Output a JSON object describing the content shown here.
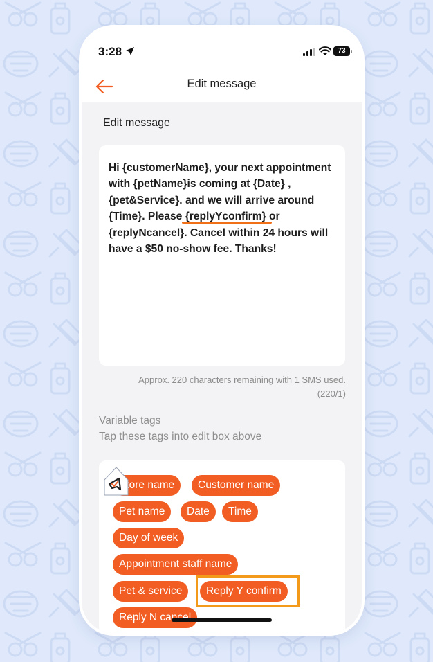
{
  "status_bar": {
    "time": "3:28",
    "battery": "73"
  },
  "nav": {
    "title": "Edit message"
  },
  "section_title": "Edit message",
  "message_lines": [
    "Hi {customerName}, your next appointment",
    "with {petName}is coming at {Date} ,",
    "{pet&Service}. and we will arrive around",
    "{Time}. Please {replyYconfirm} or",
    "{replyNcancel}. Cancel within 24 hours will",
    "have a $50 no-show fee. Thanks!"
  ],
  "char_count": {
    "line1": "Approx. 220 characters remaining with 1 SMS used.",
    "line2": "(220/1)"
  },
  "variable_tags": {
    "title": "Variable tags",
    "hint": "Tap these tags into edit box above",
    "tags": [
      "Store name",
      "Customer name",
      "Pet name",
      "Date",
      "Time",
      "Day of week",
      "Appointment staff name",
      "Pet & service",
      "Reply Y confirm",
      "Reply N cancel"
    ]
  },
  "colors": {
    "accent": "#f15d22",
    "highlight": "#f39a1a",
    "background": "#dfe9fb"
  },
  "icons": [
    "location-arrow-icon",
    "signal-icon",
    "wifi-icon",
    "battery-icon",
    "back-arrow-icon",
    "pointer-cursor-icon"
  ]
}
